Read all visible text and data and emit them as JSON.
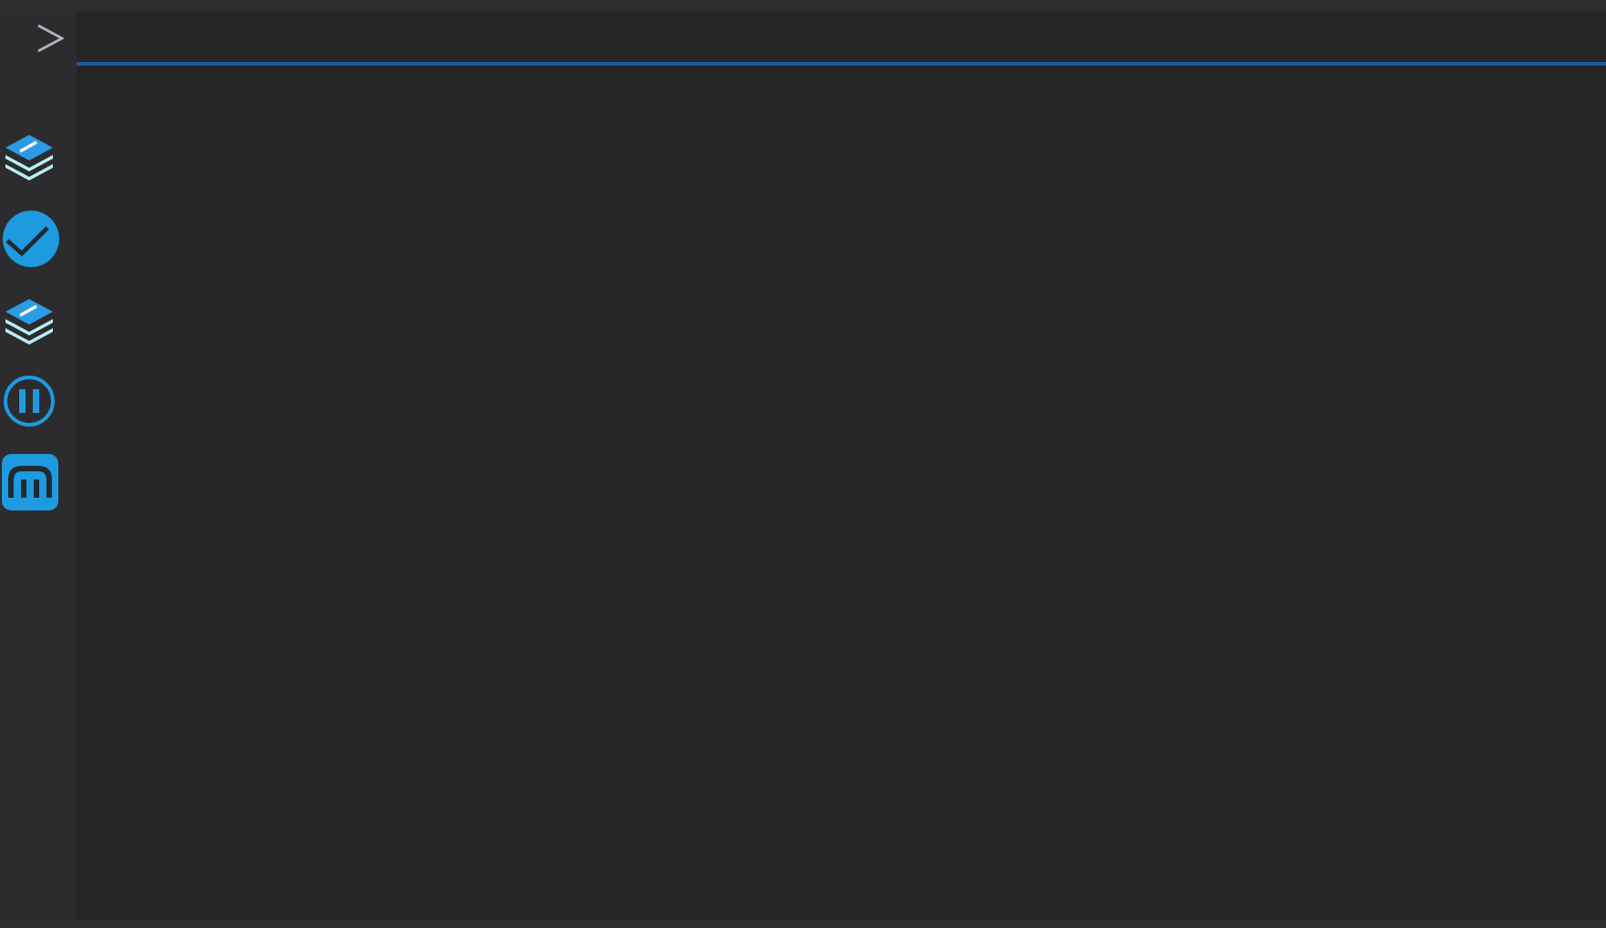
{
  "activity_bar": {
    "items": [
      {
        "kind": "layers"
      },
      {
        "kind": "check"
      },
      {
        "kind": "layers"
      },
      {
        "kind": "pause"
      },
      {
        "kind": "m-logo"
      }
    ]
  }
}
